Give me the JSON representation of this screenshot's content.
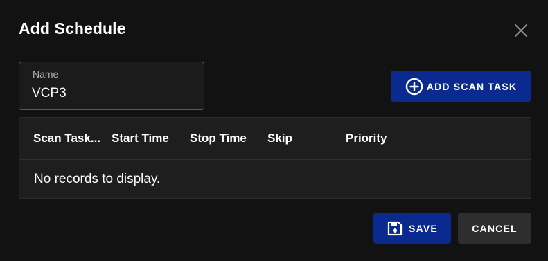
{
  "dialog": {
    "title": "Add Schedule",
    "close_icon": "close-icon"
  },
  "name_field": {
    "label": "Name",
    "value": "VCP3"
  },
  "add_scan_task": {
    "label": "ADD SCAN TASK",
    "icon": "add-circle-icon"
  },
  "table": {
    "columns": [
      "Scan Task...",
      "Start Time",
      "Stop Time",
      "Skip",
      "Priority"
    ],
    "empty_message": "No records to display."
  },
  "footer": {
    "save_label": "SAVE",
    "save_icon": "save-icon",
    "cancel_label": "CANCEL"
  },
  "colors": {
    "background": "#121212",
    "primary": "#0a2a8f",
    "secondary_button": "#2e2e2e",
    "table_bg": "#1e1e1e"
  }
}
